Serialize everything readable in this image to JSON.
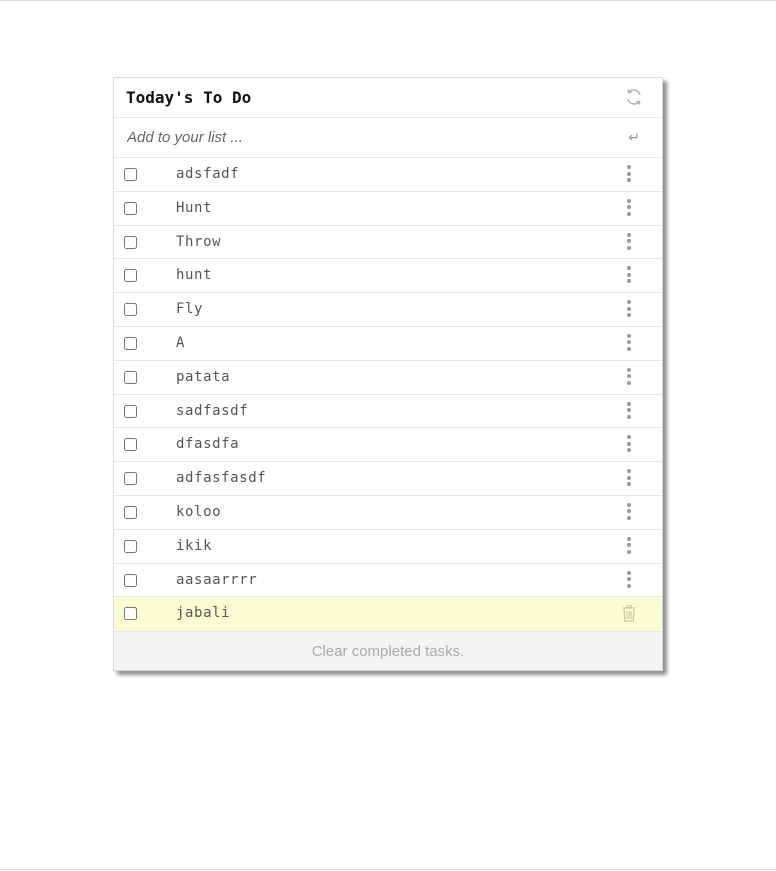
{
  "app": {
    "title": "Today's To Do",
    "refresh_icon": "refresh-icon"
  },
  "add": {
    "placeholder": "Add to your list ...",
    "enter_icon": "enter-icon"
  },
  "tasks": [
    {
      "label": "adsfadf",
      "checked": false,
      "action_icon": "more-vertical-icon"
    },
    {
      "label": "Hunt",
      "checked": false,
      "action_icon": "more-vertical-icon"
    },
    {
      "label": "Throw",
      "checked": false,
      "action_icon": "more-vertical-icon"
    },
    {
      "label": "hunt",
      "checked": false,
      "action_icon": "more-vertical-icon"
    },
    {
      "label": "Fly",
      "checked": false,
      "action_icon": "more-vertical-icon"
    },
    {
      "label": "A",
      "checked": false,
      "action_icon": "more-vertical-icon"
    },
    {
      "label": "patata",
      "checked": false,
      "action_icon": "more-vertical-icon"
    },
    {
      "label": "sadfasdf",
      "checked": false,
      "action_icon": "more-vertical-icon"
    },
    {
      "label": "dfasdfa",
      "checked": false,
      "action_icon": "more-vertical-icon"
    },
    {
      "label": "adfasfasdf",
      "checked": false,
      "action_icon": "more-vertical-icon"
    },
    {
      "label": "koloo",
      "checked": false,
      "action_icon": "more-vertical-icon"
    },
    {
      "label": "ikik",
      "checked": false,
      "action_icon": "more-vertical-icon"
    },
    {
      "label": "aasaarrrr",
      "checked": false,
      "action_icon": "more-vertical-icon"
    },
    {
      "label": "jabali",
      "checked": false,
      "action_icon": "trash-icon",
      "highlighted": true
    }
  ],
  "footer": {
    "clear_label": "Clear completed tasks."
  },
  "colors": {
    "highlight_row": "#fafdd2",
    "footer_bg": "#f4f4f4",
    "muted_text": "#aaaaaa",
    "item_text": "#555555",
    "icon_gray": "#9a9a9a"
  }
}
